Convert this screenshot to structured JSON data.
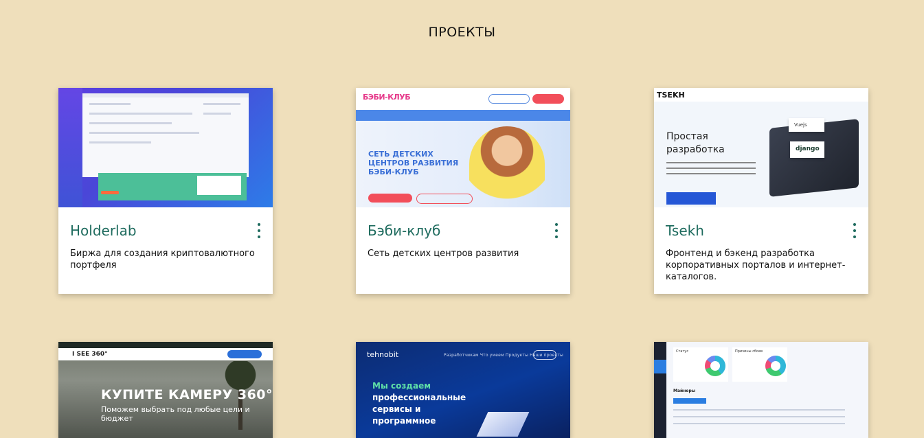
{
  "page": {
    "title": "ПРОЕКТЫ"
  },
  "projects": [
    {
      "name": "Holderlab",
      "description": "Биржа для создания криптовалютного портфеля"
    },
    {
      "name": "Бэби-клуб",
      "description": "Сеть детских центров развития",
      "thumb": {
        "logo": "БЭБИ-КЛУБ",
        "headline": "СЕТЬ ДЕТСКИХ ЦЕНТРОВ РАЗВИТИЯ БЭБИ-КЛУБ"
      }
    },
    {
      "name": "Tsekh",
      "description": "Фронтенд и бэкенд разработка корпоративных порталов и интернет-каталогов.",
      "thumb": {
        "logo": "TSEKH",
        "headline": "Простая разработка",
        "badge1": "Vuejs",
        "badge2": "django"
      }
    },
    {
      "thumb": {
        "logo": "I SEE 360°",
        "headline": "КУПИТЕ КАМЕРУ 360°",
        "subline": "Поможем выбрать под любые цели и бюджет"
      }
    },
    {
      "thumb": {
        "logo": "tehnobit",
        "nav": "Разработчикам  Что умеем  Продукты  Наши проекты",
        "headline_accent": "Мы создаем",
        "headline": "профессиональные сервисы и программное"
      }
    },
    {
      "thumb": {
        "label1": "Статус",
        "label2": "Причины сбоев",
        "section": "Майнеры"
      }
    }
  ],
  "colors": {
    "background": "#efdfbb",
    "card_title": "#1e6b5e"
  }
}
